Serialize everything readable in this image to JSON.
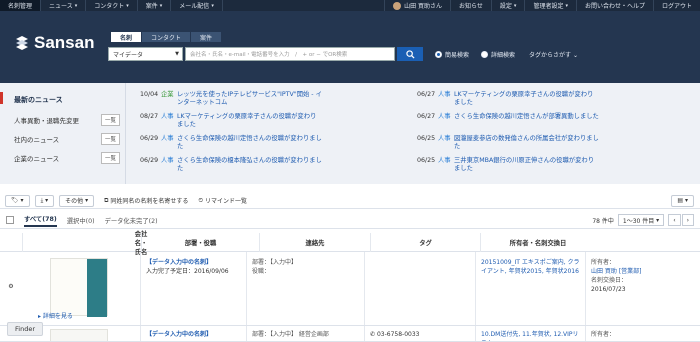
{
  "topbar": {
    "items": [
      "名刺管理",
      "ニュース",
      "コンタクト",
      "案件",
      "メール配信"
    ],
    "user_name": "山田 買助さん",
    "right_items": [
      "お知らせ",
      "設定",
      "管理者設定",
      "お問い合わせ・ヘルプ",
      "ログアウト"
    ]
  },
  "brand": {
    "logo_text": "Sansan"
  },
  "search": {
    "tabs": [
      "名刺",
      "コンタクト",
      "案件"
    ],
    "scope_value": "マイデータ",
    "placeholder": "会社名・氏名・e-mail・電話番号を入力　/　+ or − でOR検索",
    "simple_label": "簡易検索",
    "detail_label": "詳細検索",
    "tag_search_label": "タグからさがす"
  },
  "news_nav": {
    "title": "最新のニュース",
    "items": [
      {
        "label": "人事異動・退職先変更",
        "button": "一覧"
      },
      {
        "label": "社内のニュース",
        "button": "一覧"
      },
      {
        "label": "企業のニュース",
        "button": "一覧"
      }
    ]
  },
  "news": {
    "left": [
      {
        "date": "10/04",
        "cat": "企業",
        "text": "レッツ光を使ったIPテレビサービス\"IPTV\"開始 - インターネットコム"
      },
      {
        "date": "08/27",
        "cat": "人事",
        "text": "LKマーケティングの栗原幸子さんの役職が変わりました"
      },
      {
        "date": "06/29",
        "cat": "人事",
        "text": "さくら生命保険の越川定悟さんの役職が変わりました"
      },
      {
        "date": "06/29",
        "cat": "人事",
        "text": "さくら生命保険の榎本隆弘さんの役職が変わりました"
      }
    ],
    "right": [
      {
        "date": "06/27",
        "cat": "人事",
        "text": "LKマーケティングの栗原幸子さんの役職が変わりました"
      },
      {
        "date": "06/27",
        "cat": "人事",
        "text": "さくら生命保険の越川定悟さんが部署異動しました"
      },
      {
        "date": "06/25",
        "cat": "人事",
        "text": "図瀧屋麦参店の数発倫さんの所属会社が変わりました"
      },
      {
        "date": "06/25",
        "cat": "人事",
        "text": "三井東京MBA銀行の川原正伸さんの役職が変わりました"
      }
    ]
  },
  "toolbar": {
    "tag_btn": "▾",
    "download_btn": "▾",
    "other_btn": "その他",
    "same_name_label": "同姓同名の名刺を名寄せする",
    "remind_label": "リマインド一覧"
  },
  "filter": {
    "all": "すべて(78)",
    "selected": "選択中(0)",
    "in_progress": "データ化未完了(2)",
    "count_text": "78 件中",
    "range_text": "1〜30 件目"
  },
  "table": {
    "headers": [
      "会社名・氏名",
      "部署・役職",
      "連絡先",
      "タグ",
      "所有者・名刺交換日"
    ],
    "rows": [
      {
        "company_name": "【データ入力中の名刺】",
        "expected": "入力完了予定日：2016/09/06",
        "dept_label": "部署：【入力中】",
        "title_label": "役職：",
        "contact": "",
        "tags": "20151009_IT エキスポご案内, クライアント, 年賀状2015, 年賀状2016",
        "owner_label": "所有者：",
        "owner": "山田 買助 [営業部]",
        "exchange_label": "名刺交換日：",
        "exchange_date": "2016/07/23",
        "detail_link": "詳細を見る"
      },
      {
        "company_name": "【データ入力中の名刺】",
        "dept_label": "部署：【入力中】 経営企画部",
        "contact": "03-6758-0033",
        "tags": "10.DM送付先, 11.年賀状, 12.VIPリスト",
        "owner_label": "所有者："
      }
    ]
  },
  "finder_label": "Finder",
  "colors": {
    "header": "#243650",
    "topbar": "#1c2a3d",
    "accent": "#1a5fb4",
    "news_bg": "#eef1f6"
  }
}
